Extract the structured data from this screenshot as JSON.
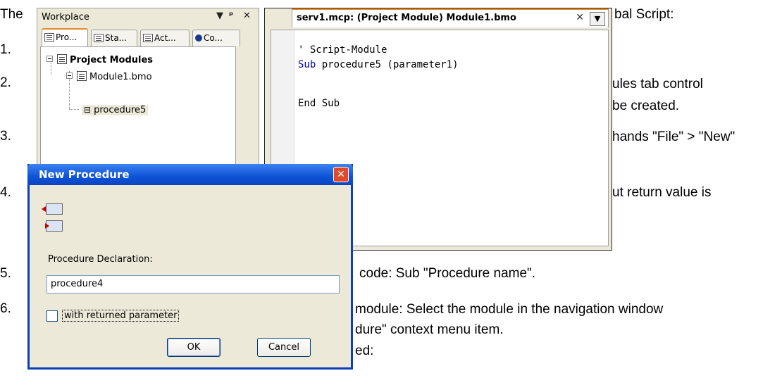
{
  "document": {
    "intro_fragment_left": "The",
    "intro_fragment_right": "bal Script:",
    "steps": [
      {
        "num": "1.",
        "text": ""
      },
      {
        "num": "2.",
        "text": "ules tab control",
        "text2": "be created."
      },
      {
        "num": "3.",
        "text": "hands \"File\" > \"New\""
      },
      {
        "num": "4.",
        "text": "ut return value is"
      },
      {
        "num": "5.",
        "text": "code: Sub \"Procedure name\"."
      },
      {
        "num": "6.",
        "text": "module: Select the module in the navigation window",
        "text2": "dure\" context menu item.",
        "text3": "ed:"
      }
    ]
  },
  "workplace": {
    "title": "Workplace",
    "controls": {
      "dropdown": "▼",
      "pin": "ᵖ",
      "close": "✕"
    },
    "tabs": [
      {
        "label": "Pro...",
        "icon": "project-icon",
        "active": true
      },
      {
        "label": "Sta...",
        "icon": "standard-icon",
        "active": false
      },
      {
        "label": "Act...",
        "icon": "action-icon",
        "active": false
      },
      {
        "label": "Co...",
        "icon": "code-icon",
        "active": false
      }
    ],
    "tree": {
      "root": "Project Modules",
      "module": "Module1.bmo",
      "procedure": "procedure5"
    }
  },
  "editor": {
    "tab_title": "serv1.mcp: (Project Module) Module1.bmo",
    "close": "✕",
    "dropdown": "▼",
    "code": {
      "comment": "' Script-Module",
      "sub_kw": "Sub",
      "sub_rest": " procedure5 (parameter1)",
      "end": "End Sub"
    }
  },
  "dialog": {
    "title": "New Procedure",
    "close": "✕",
    "label": "Procedure Declaration:",
    "input_value": "procedure4",
    "checkbox_label": "with returned parameter",
    "checked": false,
    "ok": "OK",
    "cancel": "Cancel"
  },
  "colors": {
    "title_blue": "#0a3fb8",
    "tab_accent": "#e68b2c",
    "keyword": "#0000c0",
    "comment": "#008000"
  }
}
